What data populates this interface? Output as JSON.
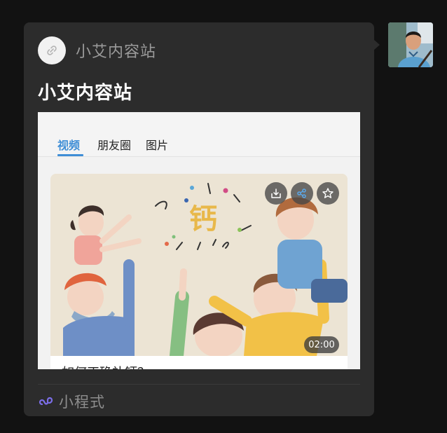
{
  "message": {
    "miniprogram_name": "小艾内容站",
    "card_title": "小艾内容站",
    "footer_label": "小程式"
  },
  "preview": {
    "tabs": [
      {
        "label": "视频",
        "active": true
      },
      {
        "label": "朋友圈",
        "active": false
      },
      {
        "label": "图片",
        "active": false
      }
    ],
    "video": {
      "duration": "02:00",
      "title": "如何正确补钙？",
      "thumb_text": "钙"
    }
  },
  "colors": {
    "background": "#121212",
    "bubble": "#2c2c2c",
    "tab_active": "#3f8ed6",
    "miniprogram_icon": "#7b6ee8"
  },
  "icons": {
    "header_logo": "link-icon",
    "download": "download-icon",
    "share": "share-icon",
    "favorite": "star-icon",
    "footer": "miniprogram-icon"
  }
}
